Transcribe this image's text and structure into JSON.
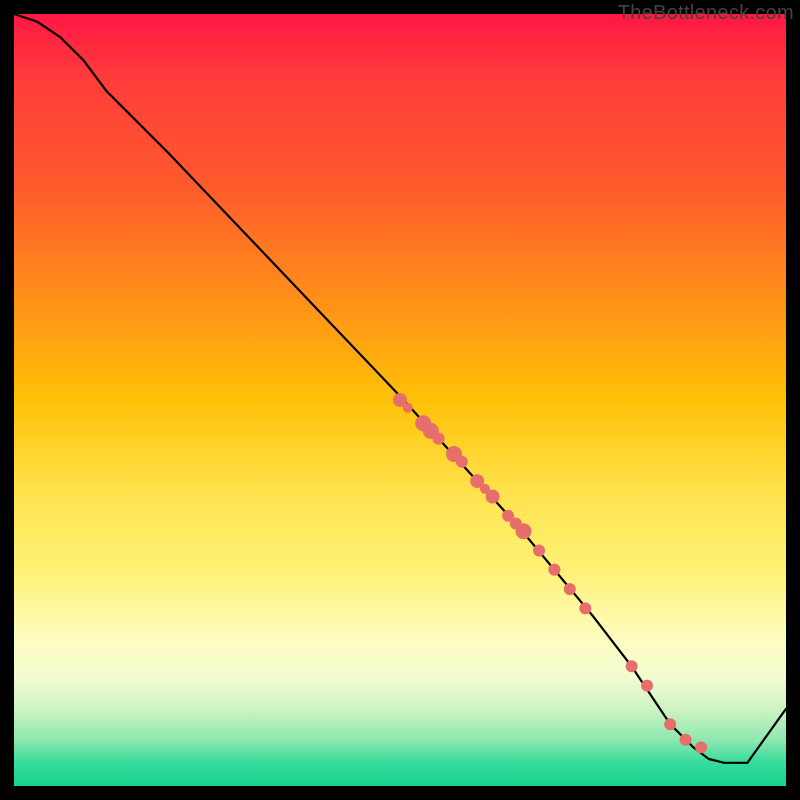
{
  "watermark": "TheBottleneck.com",
  "colors": {
    "gradient_top": "#ff1744",
    "gradient_bottom": "#18d28e",
    "curve": "#000000",
    "dot": "#e76f6b",
    "frame": "#000000"
  },
  "chart_data": {
    "type": "line",
    "title": "",
    "xlabel": "",
    "ylabel": "",
    "xlim": [
      0,
      100
    ],
    "ylim": [
      0,
      100
    ],
    "grid": false,
    "legend": false,
    "note": "Axes are normalized 0–100; no tick labels are shown on the original image. Values are visual estimates.",
    "series": [
      {
        "name": "bottleneck-curve",
        "x": [
          0,
          3,
          6,
          9,
          12,
          20,
          30,
          40,
          50,
          55,
          60,
          65,
          70,
          75,
          80,
          83,
          85,
          88,
          90,
          92,
          95,
          100
        ],
        "values": [
          100,
          99,
          97,
          94,
          90,
          82,
          71.5,
          61,
          50.5,
          45,
          39.5,
          34,
          28,
          22,
          15.5,
          11,
          8,
          5,
          3.5,
          3,
          3,
          10
        ]
      }
    ],
    "markers": {
      "name": "highlighted-points",
      "x": [
        50,
        51,
        53,
        54,
        55,
        57,
        58,
        60,
        61,
        62,
        64,
        65,
        66,
        68,
        70,
        72,
        74,
        80,
        82,
        85,
        87,
        89
      ],
      "values": [
        50,
        49,
        47,
        46,
        45,
        43,
        42,
        39.5,
        38.5,
        37.5,
        35,
        34,
        33,
        30.5,
        28,
        25.5,
        23,
        15.5,
        13,
        8,
        6,
        5
      ],
      "radius": [
        7,
        5,
        8,
        8,
        6,
        8,
        6,
        7,
        5,
        7,
        6,
        6,
        8,
        6,
        6,
        6,
        6,
        6,
        6,
        6,
        6,
        6
      ]
    }
  }
}
